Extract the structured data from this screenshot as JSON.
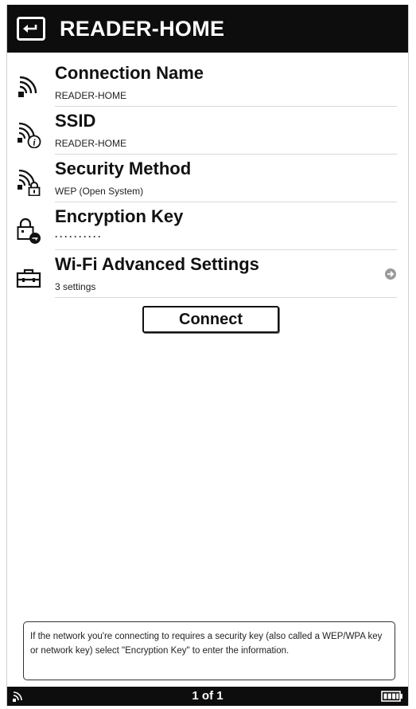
{
  "header": {
    "title": "READER-HOME",
    "back_icon": "back-arrow-icon"
  },
  "rows": [
    {
      "label": "Connection Name",
      "value": "READER-HOME",
      "icon": "wifi-signal-icon"
    },
    {
      "label": "SSID",
      "value": "READER-HOME",
      "icon": "wifi-info-icon"
    },
    {
      "label": "Security Method",
      "value": "WEP (Open System)",
      "icon": "wifi-lock-icon"
    },
    {
      "label": "Encryption Key",
      "value": "··········",
      "icon": "lock-key-icon"
    },
    {
      "label": "Wi-Fi Advanced Settings",
      "value": "3 settings",
      "icon": "toolbox-icon",
      "chevron": "chevron-right-circle-icon"
    }
  ],
  "connect_label": "Connect",
  "info_text": "If the network you're connecting to requires a security key (also called a WEP/WPA key or network key) select \"Encryption Key\" to enter the information.",
  "status": {
    "page_indicator": "1 of 1",
    "wifi_icon": "wifi-status-icon",
    "battery_icon": "battery-icon"
  }
}
